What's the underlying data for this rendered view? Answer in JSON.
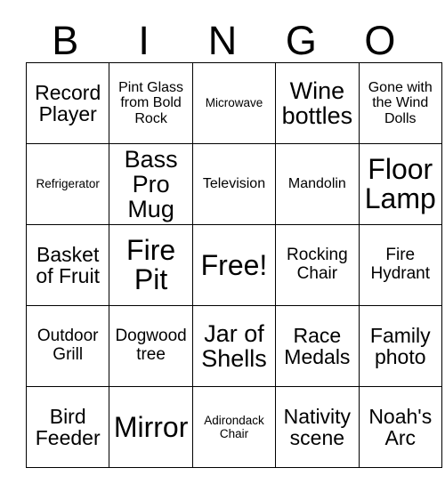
{
  "card": {
    "header_letters": [
      "B",
      "I",
      "N",
      "G",
      "O"
    ],
    "free_space_label": "Free!",
    "rows": [
      [
        {
          "label": "Record Player",
          "size": "lg"
        },
        {
          "label": "Pint Glass from Bold Rock",
          "size": "sm"
        },
        {
          "label": "Microwave",
          "size": "xs"
        },
        {
          "label": "Wine bottles",
          "size": "xl"
        },
        {
          "label": "Gone with the Wind Dolls",
          "size": "sm"
        }
      ],
      [
        {
          "label": "Refrigerator",
          "size": "xs"
        },
        {
          "label": "Bass Pro Mug",
          "size": "xl"
        },
        {
          "label": "Television",
          "size": "sm"
        },
        {
          "label": "Mandolin",
          "size": "sm"
        },
        {
          "label": "Floor Lamp",
          "size": "xxl"
        }
      ],
      [
        {
          "label": "Basket of Fruit",
          "size": "lg"
        },
        {
          "label": "Fire Pit",
          "size": "xxl"
        },
        {
          "label": "Free!",
          "size": "xxl"
        },
        {
          "label": "Rocking Chair",
          "size": "md"
        },
        {
          "label": "Fire Hydrant",
          "size": "md"
        }
      ],
      [
        {
          "label": "Outdoor Grill",
          "size": "md"
        },
        {
          "label": "Dogwood tree",
          "size": "md"
        },
        {
          "label": "Jar of Shells",
          "size": "xl"
        },
        {
          "label": "Race Medals",
          "size": "lg"
        },
        {
          "label": "Family photo",
          "size": "lg"
        }
      ],
      [
        {
          "label": "Bird Feeder",
          "size": "lg"
        },
        {
          "label": "Mirror",
          "size": "xxl"
        },
        {
          "label": "Adirondack Chair",
          "size": "xs"
        },
        {
          "label": "Nativity scene",
          "size": "lg"
        },
        {
          "label": "Noah's Arc",
          "size": "lg"
        }
      ]
    ]
  },
  "colors": {
    "background": "#ffffff",
    "text": "#000000",
    "cell_border": "#000000",
    "grid_outline": "#808080"
  }
}
